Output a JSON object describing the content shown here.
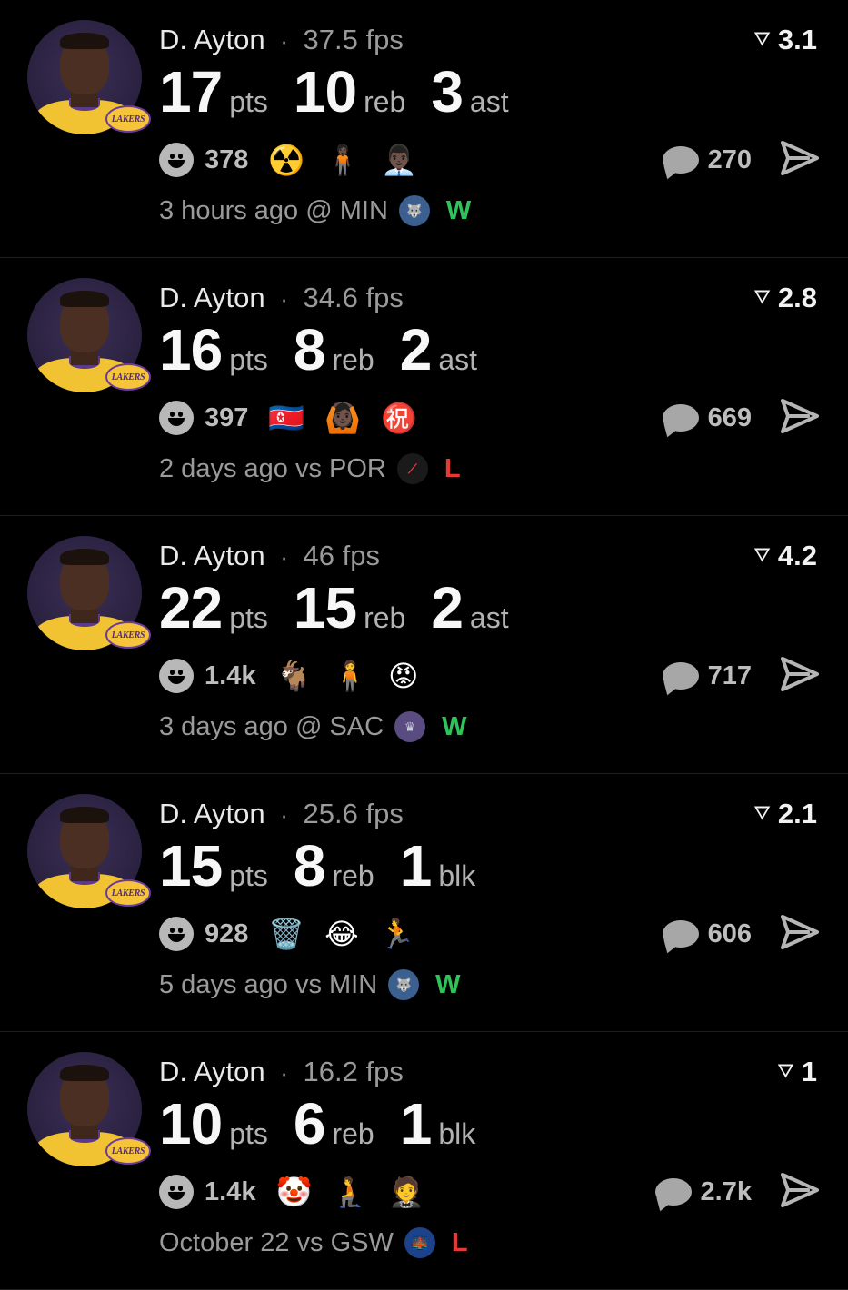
{
  "cards": [
    {
      "player": "D. Ayton",
      "separator": "·",
      "fps": "37.5 fps",
      "rating": "3.1",
      "stats": [
        {
          "value": "17",
          "label": "pts"
        },
        {
          "value": "10",
          "label": "reb"
        },
        {
          "value": "3",
          "label": "ast"
        }
      ],
      "reaction_count": "378",
      "emojis": [
        "☢️",
        "🧍🏿",
        "👨🏿‍💼"
      ],
      "comments": "270",
      "time": "3 hours ago @ MIN",
      "team_logo": "minnesota-timberwolves-logo",
      "result": "W"
    },
    {
      "player": "D. Ayton",
      "separator": "·",
      "fps": "34.6 fps",
      "rating": "2.8",
      "stats": [
        {
          "value": "16",
          "label": "pts"
        },
        {
          "value": "8",
          "label": "reb"
        },
        {
          "value": "2",
          "label": "ast"
        }
      ],
      "reaction_count": "397",
      "emojis": [
        "🇰🇵",
        "🙆🏿",
        "㊗️"
      ],
      "comments": "669",
      "time": "2 days ago vs POR",
      "team_logo": "portland-trail-blazers-logo",
      "result": "L"
    },
    {
      "player": "D. Ayton",
      "separator": "·",
      "fps": "46 fps",
      "rating": "4.2",
      "stats": [
        {
          "value": "22",
          "label": "pts"
        },
        {
          "value": "15",
          "label": "reb"
        },
        {
          "value": "2",
          "label": "ast"
        }
      ],
      "reaction_count": "1.4k",
      "emojis": [
        "🐐",
        "🧍",
        "😡"
      ],
      "comments": "717",
      "time": "3 days ago @ SAC",
      "team_logo": "sacramento-kings-logo",
      "result": "W"
    },
    {
      "player": "D. Ayton",
      "separator": "·",
      "fps": "25.6 fps",
      "rating": "2.1",
      "stats": [
        {
          "value": "15",
          "label": "pts"
        },
        {
          "value": "8",
          "label": "reb"
        },
        {
          "value": "1",
          "label": "blk"
        }
      ],
      "reaction_count": "928",
      "emojis": [
        "🗑️",
        "😂",
        "🏃"
      ],
      "comments": "606",
      "time": "5 days ago vs MIN",
      "team_logo": "minnesota-timberwolves-logo",
      "result": "W"
    },
    {
      "player": "D. Ayton",
      "separator": "·",
      "fps": "16.2 fps",
      "rating": "1",
      "stats": [
        {
          "value": "10",
          "label": "pts"
        },
        {
          "value": "6",
          "label": "reb"
        },
        {
          "value": "1",
          "label": "blk"
        }
      ],
      "reaction_count": "1.4k",
      "emojis": [
        "🤡",
        "🧎",
        "🤵"
      ],
      "comments": "2.7k",
      "time": "October 22 vs GSW",
      "team_logo": "golden-state-warriors-logo",
      "result": "L"
    }
  ],
  "colors": {
    "background": "#000000",
    "win": "#2fc45a",
    "loss": "#e53935",
    "muted": "#9a9a9a"
  },
  "icons": {
    "avatar_badge": "lakers-logo",
    "badge_text": "LAKERS",
    "rating": "rating-icon",
    "reaction": "smiley-icon",
    "comment": "comment-bubble-icon",
    "share": "send-icon"
  }
}
